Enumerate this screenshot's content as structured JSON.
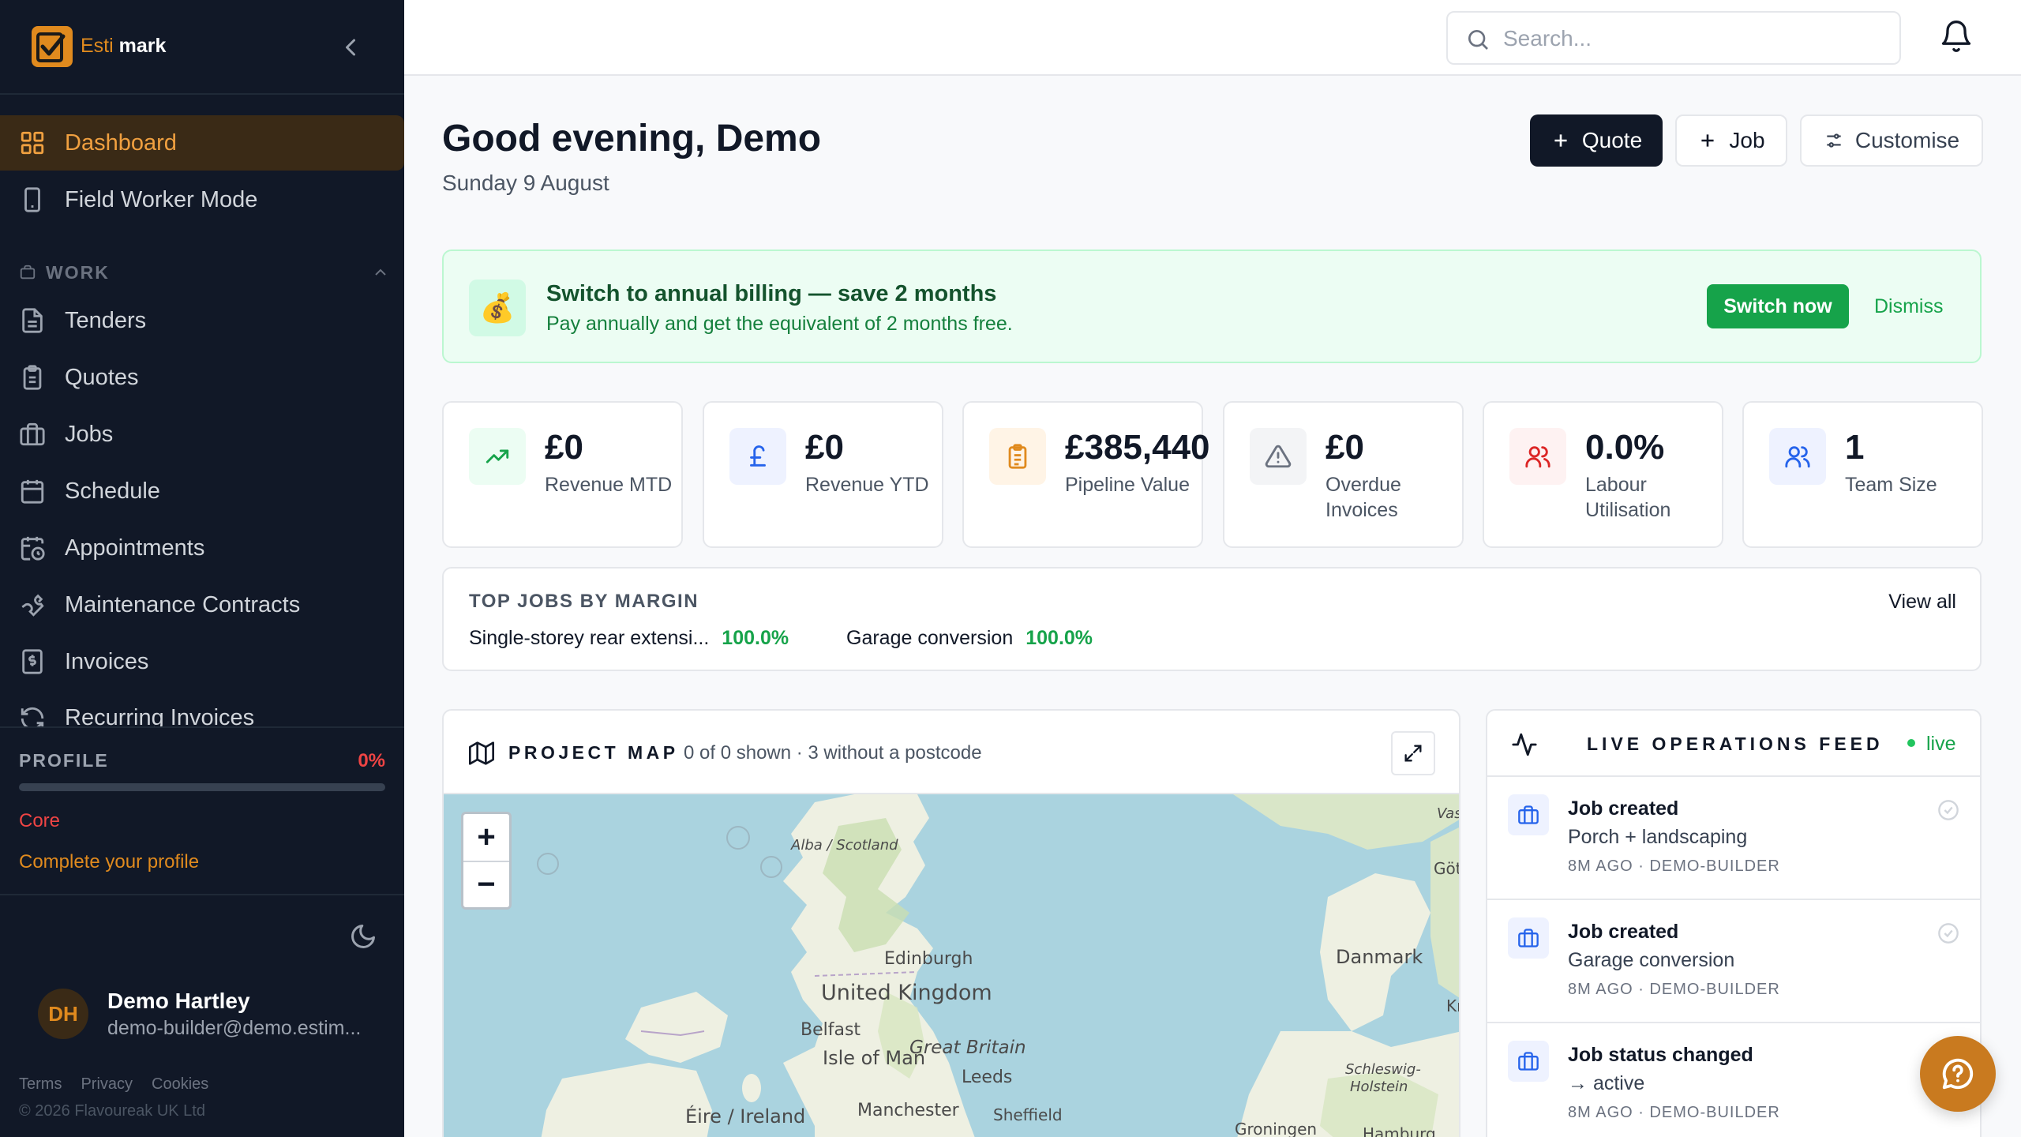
{
  "brand": {
    "name_part1": "Esti",
    "name_part2": "mark"
  },
  "nav": {
    "dashboard": "Dashboard",
    "field_worker": "Field Worker Mode",
    "section_work": "WORK",
    "tenders": "Tenders",
    "quotes": "Quotes",
    "jobs": "Jobs",
    "schedule": "Schedule",
    "appointments": "Appointments",
    "maintenance": "Maintenance Contracts",
    "invoices": "Invoices",
    "recurring": "Recurring Invoices"
  },
  "profile": {
    "label": "PROFILE",
    "percent_text": "0%",
    "percent_value": 0,
    "tier": "Core",
    "link": "Complete your profile"
  },
  "user": {
    "initials": "DH",
    "name": "Demo Hartley",
    "email": "demo-builder@demo.estim..."
  },
  "footer": {
    "terms": "Terms",
    "privacy": "Privacy",
    "cookies": "Cookies",
    "copyright": "© 2026 Flavoureak UK Ltd"
  },
  "topbar": {
    "search_placeholder": "Search..."
  },
  "header": {
    "greeting": "Good evening, Demo",
    "date": "Sunday 9 August",
    "quote_btn": "Quote",
    "job_btn": "Job",
    "customise_btn": "Customise"
  },
  "banner": {
    "emoji": "💰",
    "title": "Switch to annual billing — save 2 months",
    "subtitle": "Pay annually and get the equivalent of 2 months free.",
    "cta": "Switch now",
    "dismiss": "Dismiss"
  },
  "stats": [
    {
      "value": "£0",
      "label": "Revenue MTD",
      "icon": "trending-up-icon",
      "color": "#16a34a",
      "bg": "#ecfdf3"
    },
    {
      "value": "£0",
      "label": "Revenue YTD",
      "icon": "pound-icon",
      "color": "#2563eb",
      "bg": "#eef2ff"
    },
    {
      "value": "£385,440",
      "label": "Pipeline Value",
      "icon": "clipboard-icon",
      "color": "#e08a1e",
      "bg": "#fff4e6"
    },
    {
      "value": "£0",
      "label": "Overdue Invoices",
      "icon": "warning-icon",
      "color": "#6b7280",
      "bg": "#f3f4f6"
    },
    {
      "value": "0.0%",
      "label": "Labour Utilisation",
      "icon": "users-icon",
      "color": "#dc2626",
      "bg": "#fef2f2"
    },
    {
      "value": "1",
      "label": "Team Size",
      "icon": "team-icon",
      "color": "#2563eb",
      "bg": "#eef2ff"
    }
  ],
  "top_jobs": {
    "title": "TOP JOBS BY MARGIN",
    "view_all": "View all",
    "items": [
      {
        "name": "Single-storey rear extensi...",
        "margin": "100.0%"
      },
      {
        "name": "Garage conversion",
        "margin": "100.0%"
      }
    ]
  },
  "map": {
    "title": "PROJECT MAP",
    "subtitle": "0 of 0 shown · 3 without a postcode",
    "zoom_in": "+",
    "zoom_out": "−",
    "labels": {
      "scotland": "Alba / Scotland",
      "edinburgh": "Edinburgh",
      "uk": "United Kingdom",
      "belfast": "Belfast",
      "isle_of_man": "Isle of Man",
      "great_britain": "Great Britain",
      "leeds": "Leeds",
      "manchester": "Manchester",
      "sheffield": "Sheffield",
      "ireland": "Éire / Ireland",
      "danmark": "Danmark",
      "schleswig_1": "Schleswig-",
      "schleswig_2": "Holstein",
      "groningen": "Groningen",
      "hamburg": "Hamburg",
      "got": "Göt",
      "vas": "Vas",
      "ki": "Kı"
    }
  },
  "feed": {
    "title": "LIVE OPERATIONS FEED",
    "live": "live",
    "items": [
      {
        "title": "Job created",
        "detail": "Porch + landscaping",
        "meta": "8M AGO · DEMO-BUILDER"
      },
      {
        "title": "Job created",
        "detail": "Garage conversion",
        "meta": "8M AGO · DEMO-BUILDER"
      },
      {
        "title": "Job status changed",
        "detail": "→ active",
        "meta": "8M AGO · DEMO-BUILDER"
      }
    ]
  }
}
